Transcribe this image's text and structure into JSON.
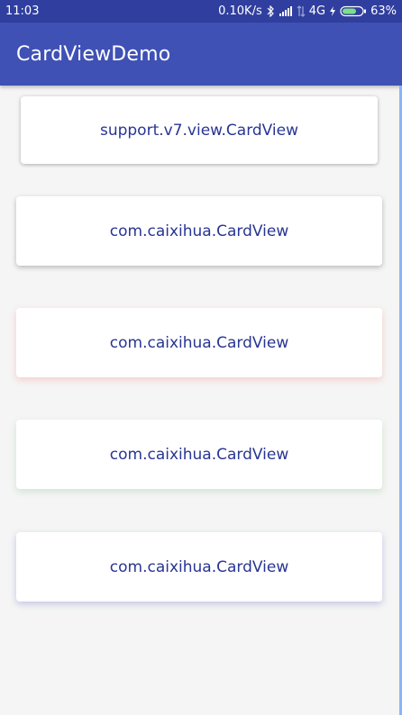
{
  "status_bar": {
    "time": "11:03",
    "speed": "0.10K/s",
    "network": "4G",
    "battery": "63%"
  },
  "app_bar": {
    "title": "CardViewDemo"
  },
  "cards": [
    {
      "label": "support.v7.view.CardView"
    },
    {
      "label": "com.caixihua.CardView"
    },
    {
      "label": "com.caixihua.CardView"
    },
    {
      "label": "com.caixihua.CardView"
    },
    {
      "label": "com.caixihua.CardView"
    }
  ],
  "colors": {
    "status_bar": "#303f9f",
    "app_bar": "#3f51b5",
    "card_text": "#283593",
    "background": "#f5f5f5",
    "card3_shadow": "#f44336",
    "card4_shadow": "#4caf50",
    "card5_shadow": "#3f51b5"
  }
}
